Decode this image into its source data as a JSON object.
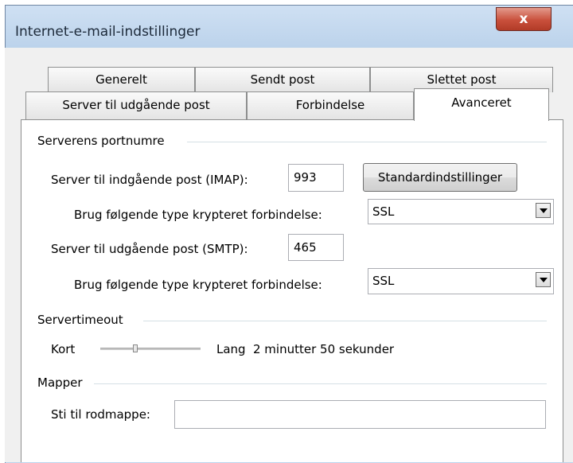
{
  "window": {
    "title": "Internet-e-mail-indstillinger",
    "close_label": "x"
  },
  "tabs_row1": [
    "Generelt",
    "Sendt post",
    "Slettet post"
  ],
  "tabs_row2": [
    "Server til udgående post",
    "Forbindelse",
    "Avanceret"
  ],
  "active_tab": "Avanceret",
  "ports": {
    "group_label": "Serverens portnumre",
    "imap_label": "Server til indgående post (IMAP):",
    "imap_value": "993",
    "defaults_button": "Standardindstillinger",
    "imap_encryption_label": "Brug følgende type krypteret forbindelse:",
    "imap_encryption_value": "SSL",
    "smtp_label": "Server til udgående post (SMTP):",
    "smtp_value": "465",
    "smtp_encryption_label": "Brug følgende type krypteret forbindelse:",
    "smtp_encryption_value": "SSL"
  },
  "timeout": {
    "group_label": "Servertimeout",
    "short_label": "Kort",
    "long_label": "Lang",
    "value_text": "2 minutter 50 sekunder",
    "slider_level": 0.35
  },
  "folders": {
    "group_label": "Mapper",
    "root_label": "Sti til rodmappe:",
    "root_value": ""
  }
}
